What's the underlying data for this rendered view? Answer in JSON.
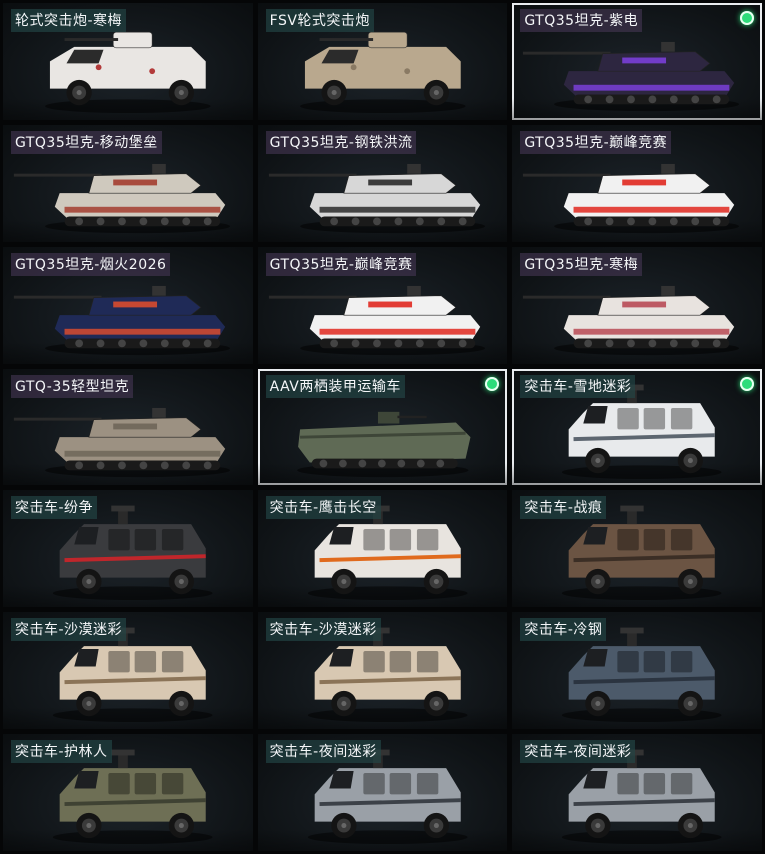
{
  "accent": {
    "selected_border": "#e9ecef",
    "equipped_badge": "#2ddc7a"
  },
  "items": [
    {
      "name": "轮式突击炮-寒梅",
      "kind": "wheeled-gun",
      "body": "#e9e6e3",
      "accent": "#b33a3a",
      "selected": false,
      "equipped": false
    },
    {
      "name": "FSV轮式突击炮",
      "kind": "wheeled-gun",
      "body": "#b9a88e",
      "accent": "#8a7a64",
      "selected": false,
      "equipped": false
    },
    {
      "name": "GTQ35坦克-紫电",
      "kind": "tank",
      "body": "#2d2640",
      "accent": "#7a3fd8",
      "selected": true,
      "equipped": true
    },
    {
      "name": "GTQ35坦克-移动堡垒",
      "kind": "tank",
      "body": "#cfc9be",
      "accent": "#a33d2f",
      "selected": false,
      "equipped": false
    },
    {
      "name": "GTQ35坦克-钢铁洪流",
      "kind": "tank",
      "body": "#d7d7d7",
      "accent": "#2a2a2a",
      "selected": false,
      "equipped": false
    },
    {
      "name": "GTQ35坦克-巅峰竞赛",
      "kind": "tank",
      "body": "#f1f1f1",
      "accent": "#e0281f",
      "selected": false,
      "equipped": false
    },
    {
      "name": "GTQ35坦克-烟火2026",
      "kind": "tank",
      "body": "#1f2a57",
      "accent": "#d84b2f",
      "selected": false,
      "equipped": false
    },
    {
      "name": "GTQ35坦克-巅峰竞赛",
      "kind": "tank",
      "body": "#f1f1f1",
      "accent": "#e0281f",
      "selected": false,
      "equipped": false
    },
    {
      "name": "GTQ35坦克-寒梅",
      "kind": "tank",
      "body": "#e8e3df",
      "accent": "#b84a55",
      "selected": false,
      "equipped": false
    },
    {
      "name": "GTQ-35轻型坦克",
      "kind": "tank",
      "body": "#9c9182",
      "accent": "#6f6659",
      "selected": false,
      "equipped": false
    },
    {
      "name": "AAV两栖装甲运输车",
      "kind": "amphibious",
      "body": "#5f6a55",
      "accent": "#3e4638",
      "selected": true,
      "equipped": true
    },
    {
      "name": "突击车-雪地迷彩",
      "kind": "assault",
      "body": "#e8eaec",
      "accent": "#5d6670",
      "selected": true,
      "equipped": true
    },
    {
      "name": "突击车-纷争",
      "kind": "assault",
      "body": "#3a3b3e",
      "accent": "#c0262b",
      "selected": false,
      "equipped": false
    },
    {
      "name": "突击车-鹰击长空",
      "kind": "assault",
      "body": "#e8e4df",
      "accent": "#e06a1d",
      "selected": false,
      "equipped": false
    },
    {
      "name": "突击车-战痕",
      "kind": "assault",
      "body": "#6b5443",
      "accent": "#3b2e25",
      "selected": false,
      "equipped": false
    },
    {
      "name": "突击车-沙漠迷彩",
      "kind": "assault",
      "body": "#d8c8b2",
      "accent": "#8b7458",
      "selected": false,
      "equipped": false
    },
    {
      "name": "突击车-沙漠迷彩",
      "kind": "assault",
      "body": "#d8c8b2",
      "accent": "#8b7458",
      "selected": false,
      "equipped": false
    },
    {
      "name": "突击车-冷钢",
      "kind": "assault",
      "body": "#4c5a6a",
      "accent": "#2b3440",
      "selected": false,
      "equipped": false
    },
    {
      "name": "突击车-护林人",
      "kind": "assault",
      "body": "#6e6f55",
      "accent": "#3f4233",
      "selected": false,
      "equipped": false
    },
    {
      "name": "突击车-夜间迷彩",
      "kind": "assault",
      "body": "#9aa0a7",
      "accent": "#3c4148",
      "selected": false,
      "equipped": false
    },
    {
      "name": "突击车-夜间迷彩",
      "kind": "assault",
      "body": "#9aa0a7",
      "accent": "#3c4148",
      "selected": false,
      "equipped": false
    }
  ]
}
